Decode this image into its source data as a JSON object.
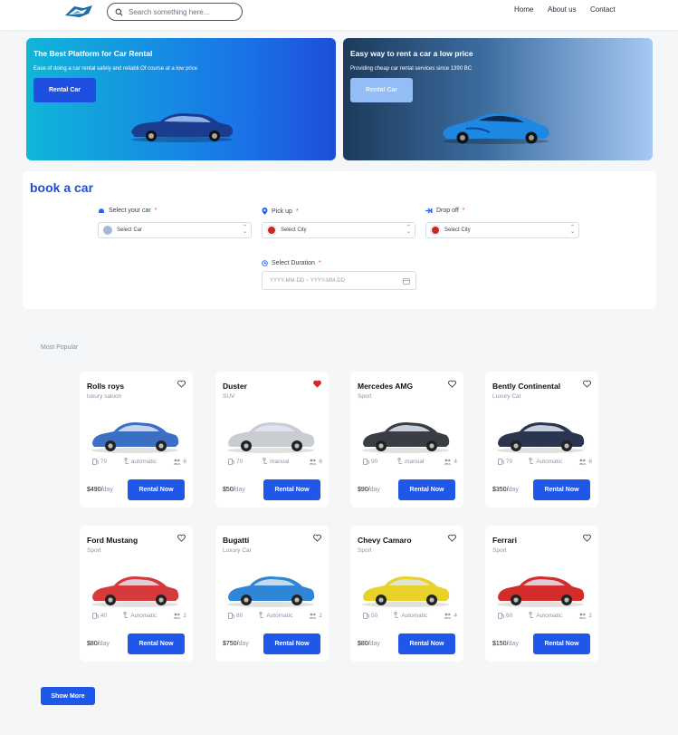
{
  "header": {
    "search_placeholder": "Search something here...",
    "nav": {
      "home": "Home",
      "about": "About us",
      "contact": "Contact"
    }
  },
  "banners": [
    {
      "title": "The Best Platform for Car Rental",
      "subtitle": "Ease of doing a car rental safely and reliabli.Of course at a low price",
      "button": "Rental Car"
    },
    {
      "title": "Easy way to rent a car a low price",
      "subtitle": "Providing cheap car rental services since 1390 BC",
      "button": "Rental Car"
    }
  ],
  "booking": {
    "title": "book a car",
    "car": {
      "label": "Select your car",
      "required": "*",
      "value": "Select Car"
    },
    "pickup": {
      "label": "Pick up",
      "required": "*",
      "value": "Select City"
    },
    "dropoff": {
      "label": "Drop off",
      "required": "*",
      "value": "Select City"
    },
    "duration": {
      "label": "Select Duration",
      "required": "*",
      "placeholder": "YYYY-MM-DD ~ YYYY-MM-DD"
    }
  },
  "popular_label": "Most Popular",
  "cars": [
    {
      "name": "Rolls roys",
      "type": "luxury saloon",
      "fuel": "70",
      "transmission": "automatic",
      "seats": "6",
      "price": "$490/",
      "per": "day",
      "button": "Rental Now",
      "liked": false,
      "color": "#3b6fc4"
    },
    {
      "name": "Duster",
      "type": "SUV",
      "fuel": "70",
      "transmission": "manual",
      "seats": "6",
      "price": "$50/",
      "per": "day",
      "button": "Rental Now",
      "liked": true,
      "color": "#c9ccd1"
    },
    {
      "name": "Mercedes AMG",
      "type": "Sport",
      "fuel": "90",
      "transmission": "manual",
      "seats": "4",
      "price": "$90/",
      "per": "day",
      "button": "Rental Now",
      "liked": false,
      "color": "#3a3d44"
    },
    {
      "name": "Bently Continental",
      "type": "Luxury Car",
      "fuel": "70",
      "transmission": "Automatic",
      "seats": "6",
      "price": "$350/",
      "per": "day",
      "button": "Rental Now",
      "liked": false,
      "color": "#2b3550"
    },
    {
      "name": "Ford Mustang",
      "type": "Sport",
      "fuel": "40",
      "transmission": "Automatic",
      "seats": "2",
      "price": "$80/",
      "per": "day",
      "button": "Rental Now",
      "liked": false,
      "color": "#d63a3a"
    },
    {
      "name": "Bugatti",
      "type": "Luxury Car",
      "fuel": "80",
      "transmission": "Automatic",
      "seats": "2",
      "price": "$750/",
      "per": "day",
      "button": "Rental Now",
      "liked": false,
      "color": "#2f86d6"
    },
    {
      "name": "Chevy Camaro",
      "type": "Sport",
      "fuel": "50",
      "transmission": "Automatic",
      "seats": "4",
      "price": "$80/",
      "per": "day",
      "button": "Rental Now",
      "liked": false,
      "color": "#e8d22a"
    },
    {
      "name": "Ferrari",
      "type": "Sport",
      "fuel": "60",
      "transmission": "Automatic",
      "seats": "2",
      "price": "$150/",
      "per": "day",
      "button": "Rental Now",
      "liked": false,
      "color": "#d42b2b"
    }
  ],
  "show_more": "Show More",
  "colors": {
    "primary": "#1f57e8",
    "heart_active": "#d62828"
  }
}
